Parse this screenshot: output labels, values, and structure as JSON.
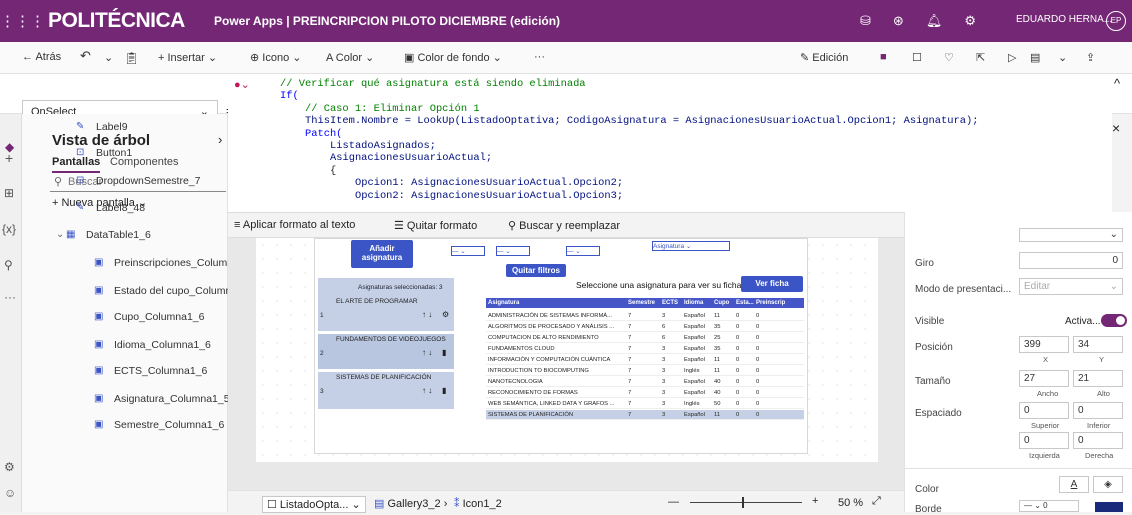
{
  "topbar": {
    "brand": "POLITÉCNICA",
    "title": "Power Apps  |  PREINCRIPCION PILOTO DICIEMBRE (edición)",
    "user": "EDUARDO HERNA...",
    "avatar": "EP"
  },
  "cmdbar": {
    "back": "Atrás",
    "insert": "Insertar",
    "icon": "Icono",
    "color": "Color",
    "bgcolor": "Color de fondo",
    "more": "···",
    "edit": "Edición"
  },
  "formula": {
    "property": "OnSelect",
    "eq": "=",
    "fx": "fx",
    "lines": [
      {
        "p": "",
        "c": "// Verificar qué asignatura está siendo eliminada",
        "t": "cm"
      },
      {
        "p": "",
        "c": "If(",
        "t": "kw"
      },
      {
        "p": "    ",
        "c": "// Caso 1: Eliminar Opción 1",
        "t": "cm"
      },
      {
        "p": "    ",
        "c": "ThisItem.Nombre = LookUp(ListadoOptativa; CodigoAsignatura = AsignacionesUsuarioActual.Opcion1; Asignatura);",
        "t": "id"
      },
      {
        "p": "    ",
        "c": "Patch(",
        "t": "kw"
      },
      {
        "p": "        ",
        "c": "ListadoAsignados;",
        "t": "id"
      },
      {
        "p": "        ",
        "c": "AsignacionesUsuarioActual;",
        "t": "id"
      },
      {
        "p": "        ",
        "c": "{",
        "t": "pl"
      },
      {
        "p": "            ",
        "c": "Opcion1: AsignacionesUsuarioActual.Opcion2;",
        "t": "id"
      },
      {
        "p": "            ",
        "c": "Opcion2: AsignacionesUsuarioActual.Opcion3;",
        "t": "id"
      }
    ]
  },
  "fmtbar": {
    "format": "Aplicar formato al texto",
    "unformat": "Quitar formato",
    "find": "Buscar y reemplazar"
  },
  "tree": {
    "title": "Vista de árbol",
    "tab_screens": "Pantallas",
    "tab_components": "Componentes",
    "search_placeholder": "Buscar",
    "new_screen": "Nueva pantalla",
    "items": [
      {
        "label": "Label9",
        "icon": "label-icon"
      },
      {
        "label": "Button1",
        "icon": "button-icon"
      },
      {
        "label": "DropdownSemestre_7",
        "icon": "dropdown-icon"
      },
      {
        "label": "Label8_48",
        "icon": "label-icon"
      },
      {
        "label": "DataTable1_6",
        "icon": "table-icon"
      },
      {
        "label": "Preinscripciones_Columna1_6",
        "icon": "column-icon"
      },
      {
        "label": "Estado del cupo_Columna1_6",
        "icon": "column-icon"
      },
      {
        "label": "Cupo_Columna1_6",
        "icon": "column-icon"
      },
      {
        "label": "Idioma_Columna1_6",
        "icon": "column-icon"
      },
      {
        "label": "ECTS_Columna1_6",
        "icon": "column-icon"
      },
      {
        "label": "Asignatura_Columna1_5",
        "icon": "column-icon"
      },
      {
        "label": "Semestre_Columna1_6",
        "icon": "column-icon"
      }
    ]
  },
  "app": {
    "add_btn": "Añadir asignatura",
    "clear_btn": "Quitar filtros",
    "selected_label": "Asignaturas seleccionadas: 3",
    "hint": "Seleccione una asignatura para ver su ficha",
    "view_btn": "Ver ficha",
    "dd_asig": "Asignatura",
    "gallery": [
      {
        "num": "1",
        "name": "EL ARTE DE PROGRAMAR"
      },
      {
        "num": "2",
        "name": "FUNDAMENTOS DE VIDEOJUEGOS"
      },
      {
        "num": "3",
        "name": "SISTEMAS DE PLANIFICACIÓN"
      }
    ],
    "table_headers": [
      "Asignatura",
      "Semestre",
      "ECTS",
      "Idioma",
      "Cupo",
      "Esta...",
      "Preinscrip"
    ],
    "rows": [
      [
        "ADMINISTRACIÓN DE SISTEMAS INFORMÁ...",
        "7",
        "3",
        "Español",
        "11",
        "0",
        "0"
      ],
      [
        "ALGORITMOS DE PROCESADO Y ANÁLISIS ...",
        "7",
        "6",
        "Español",
        "35",
        "0",
        "0"
      ],
      [
        "COMPUTACION DE ALTO RENDIMIENTO",
        "7",
        "6",
        "Español",
        "25",
        "0",
        "0"
      ],
      [
        "FUNDAMENTOS CLOUD",
        "7",
        "3",
        "Español",
        "35",
        "0",
        "0"
      ],
      [
        "INFORMACIÓN Y COMPUTACIÓN CUÁNTICA",
        "7",
        "3",
        "Español",
        "11",
        "0",
        "0"
      ],
      [
        "INTRODUCTION TO BIOCOMPUTING",
        "7",
        "3",
        "Inglés",
        "11",
        "0",
        "0"
      ],
      [
        "NANOTECNOLOGIA",
        "7",
        "3",
        "Español",
        "40",
        "0",
        "0"
      ],
      [
        "RECONOCIMIENTO DE FORMAS",
        "7",
        "3",
        "Español",
        "40",
        "0",
        "0"
      ],
      [
        "WEB SEMÁNTICA, LINKED DATA Y GRAFOS ...",
        "7",
        "3",
        "Inglés",
        "50",
        "0",
        "0"
      ],
      [
        "SISTEMAS DE PLANIFICACIÓN",
        "7",
        "3",
        "Español",
        "11",
        "0",
        "0"
      ]
    ]
  },
  "props": {
    "giro_label": "Giro",
    "giro": "0",
    "modo_label": "Modo de presentaci...",
    "modo": "Editar",
    "visible_label": "Visible",
    "visible": "Activa...",
    "pos_label": "Posición",
    "x": "399",
    "y": "34",
    "x_lbl": "X",
    "y_lbl": "Y",
    "size_label": "Tamaño",
    "w": "27",
    "h": "21",
    "w_lbl": "Ancho",
    "h_lbl": "Alto",
    "spacing_label": "Espaciado",
    "sup": "0",
    "inf": "0",
    "izq": "0",
    "der": "0",
    "sup_lbl": "Superior",
    "inf_lbl": "Inferior",
    "izq_lbl": "Izquierda",
    "der_lbl": "Derecha",
    "color_label": "Color",
    "border_label": "Borde",
    "border_val": "0"
  },
  "status": {
    "crumb1": "ListadoOpta...",
    "crumb2": "Gallery3_2",
    "crumb3": "Icon1_2",
    "zoom": "50 %",
    "zoom_minus": "—",
    "zoom_plus": "+"
  },
  "colors": {
    "brand": "#742774",
    "accent": "#3b55c7"
  }
}
